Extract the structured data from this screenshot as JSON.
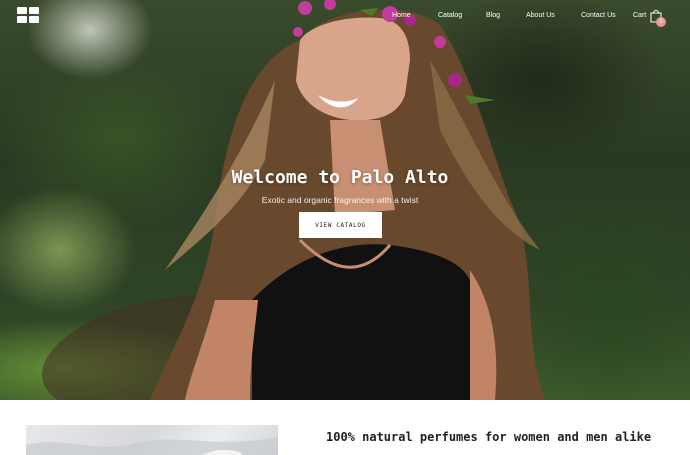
{
  "nav": {
    "items": [
      "Home",
      "Catalog",
      "Blog",
      "About Us",
      "Contact Us"
    ],
    "cart_label": "Cart",
    "cart_count": "0"
  },
  "hero": {
    "title": "Welcome to Palo Alto",
    "subtitle": "Exotic and organic fragrances with a twist",
    "cta_label": "VIEW CATALOG"
  },
  "section": {
    "title": "100% natural perfumes for women and men alike"
  },
  "colors": {
    "cart_badge": "#e39a8f",
    "cta_background": "#ffffff",
    "text_dark": "#222222"
  },
  "icons": {
    "logo": "four-squares-logo",
    "cart": "shopping-bag-icon"
  }
}
